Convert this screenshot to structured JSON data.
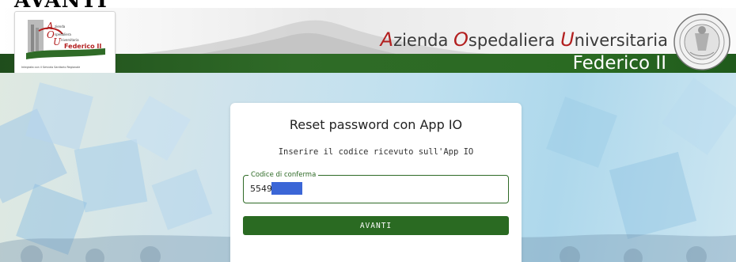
{
  "top_clipped_heading": "AVANTI",
  "header": {
    "logo_fine_print": "Integrata con il Servizio Sanitario Regionale",
    "brand": {
      "word1_cap": "A",
      "word1_rest": "zienda ",
      "word2_cap": "O",
      "word2_rest": "spedaliera ",
      "word3_cap": "U",
      "word3_rest": "niversitaria",
      "subtitle": "Federico II"
    },
    "logo_lines": [
      "zienda",
      "spedaliera",
      "niversitaria",
      "Federico II"
    ]
  },
  "card": {
    "title": "Reset password con App IO",
    "subtitle": "Inserire il codice ricevuto sull'App IO",
    "field": {
      "label": "Codice di conferma",
      "value": "5549"
    },
    "button_label": "AVANTI"
  },
  "colors": {
    "brand_green": "#2a6a22",
    "brand_red": "#b21f1f",
    "redaction": "#3b66d6"
  },
  "icons": {
    "logo": "aou-logo",
    "seal": "university-seal-icon"
  }
}
